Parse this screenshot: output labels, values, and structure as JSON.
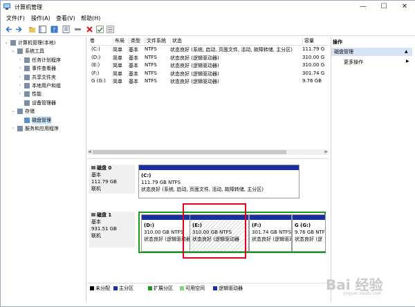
{
  "window": {
    "title": "计算机管理"
  },
  "menu": [
    "文件(F)",
    "操作(A)",
    "查看(V)",
    "帮助(H)"
  ],
  "tree": [
    {
      "label": "计算机管理(本地)",
      "indent": 0,
      "arrow": "⌄",
      "icon": "computer-icon"
    },
    {
      "label": "系统工具",
      "indent": 1,
      "arrow": "⌄",
      "icon": "tools-icon"
    },
    {
      "label": "任务计划程序",
      "indent": 2,
      "arrow": "›",
      "icon": "clock-icon"
    },
    {
      "label": "事件查看器",
      "indent": 2,
      "arrow": "›",
      "icon": "event-icon"
    },
    {
      "label": "共享文件夹",
      "indent": 2,
      "arrow": "›",
      "icon": "folder-icon"
    },
    {
      "label": "本地用户和组",
      "indent": 2,
      "arrow": "›",
      "icon": "users-icon"
    },
    {
      "label": "性能",
      "indent": 2,
      "arrow": "›",
      "icon": "performance-icon"
    },
    {
      "label": "设备管理器",
      "indent": 2,
      "arrow": "",
      "icon": "device-icon"
    },
    {
      "label": "存储",
      "indent": 1,
      "arrow": "⌄",
      "icon": "storage-icon"
    },
    {
      "label": "磁盘管理",
      "indent": 2,
      "arrow": "",
      "icon": "disk-icon",
      "selected": true
    },
    {
      "label": "服务和应用程序",
      "indent": 1,
      "arrow": "›",
      "icon": "services-icon"
    }
  ],
  "volumes": {
    "headers": [
      "卷",
      "布局",
      "类型",
      "文件系统",
      "状态",
      "容量"
    ],
    "rows": [
      [
        "(C:)",
        "简单",
        "基本",
        "NTFS",
        "状态良好 (系统, 启动, 页面文件, 活动, 故障转储, 主分区)",
        "111.79 G"
      ],
      [
        "(D:)",
        "简单",
        "基本",
        "NTFS",
        "状态良好 (逻辑驱动器)",
        "310.00 G"
      ],
      [
        "(E:)",
        "简单",
        "基本",
        "NTFS",
        "状态良好 (逻辑驱动器)",
        "310.00 G"
      ],
      [
        "(F:)",
        "简单",
        "基本",
        "NTFS",
        "状态良好 (逻辑驱动器)",
        "301.74 G"
      ],
      [
        "G (G:)",
        "简单",
        "基本",
        "NTFS",
        "状态良好 (逻辑驱动器)",
        "9.76 GB"
      ]
    ]
  },
  "disks": [
    {
      "name": "磁盘 0",
      "type": "基本",
      "size": "111.79 GB",
      "status": "联机",
      "partitions": [
        {
          "name": "(C:)",
          "size": "111.79 GB NTFS",
          "status": "状态良好 (系统, 启动, 页面文件, 活动, 故障转储, 主分区)"
        }
      ]
    },
    {
      "name": "磁盘 1",
      "type": "基本",
      "size": "931.51 GB",
      "status": "联机",
      "partitions": [
        {
          "name": "(D:)",
          "size": "310.00 GB NTFS",
          "status": "状态良好 (逻辑驱动器"
        },
        {
          "name": "(E:)",
          "size": "310.00 GB NTFS",
          "status": "状态良好 (逻辑驱动器"
        },
        {
          "name": "(F:)",
          "size": "301.74 GB NTFS",
          "status": "状态良好 (逻辑驱动器"
        },
        {
          "name": "G (G:)",
          "size": "9.76 GB NTF",
          "status": "状态良好 (逻"
        }
      ]
    }
  ],
  "legend": [
    {
      "label": "未分配",
      "color": "#000000"
    },
    {
      "label": "主分区",
      "color": "#1a2fa0"
    },
    {
      "label": "扩展分区",
      "color": "#1a9a1a"
    },
    {
      "label": "可用空间",
      "color": "#7cd67c"
    },
    {
      "label": "逻辑驱动器",
      "color": "#1a2fa0"
    }
  ],
  "actions": {
    "title": "操作",
    "section": "磁盘管理",
    "more": "更多操作"
  },
  "watermark": {
    "main": "Bai 经验",
    "sub": "jingyan.baidu.com"
  }
}
